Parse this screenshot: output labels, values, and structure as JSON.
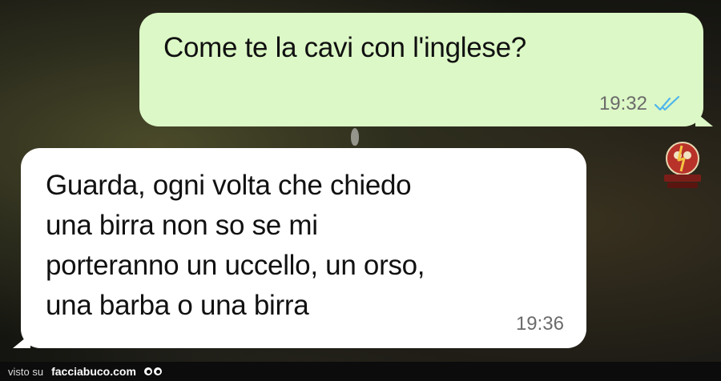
{
  "conversation": {
    "outgoing": {
      "text": "Come te la cavi con l'inglese?",
      "time": "19:32",
      "status_icon": "double-check-read-icon",
      "status_color": "#4fb5ec"
    },
    "incoming": {
      "lines": [
        "Guarda, ogni volta che chiedo",
        "una birra non so se mi",
        "porteranno un uccello, un orso,",
        "una barba o una birra"
      ],
      "time": "19:36"
    }
  },
  "colors": {
    "outgoing_bubble": "#dcf8c6",
    "incoming_bubble": "#ffffff",
    "timestamp": "#6b6b6b"
  },
  "watermark": {
    "icon": "rovinare-rapporti-logo",
    "text": "ROVINARE RAPPORTI CON GLI ITTE INFERNI"
  },
  "footer": {
    "visto_label": "visto su",
    "site_label": "facciabuco.com",
    "logo_icon": "eyes-logo-icon"
  }
}
